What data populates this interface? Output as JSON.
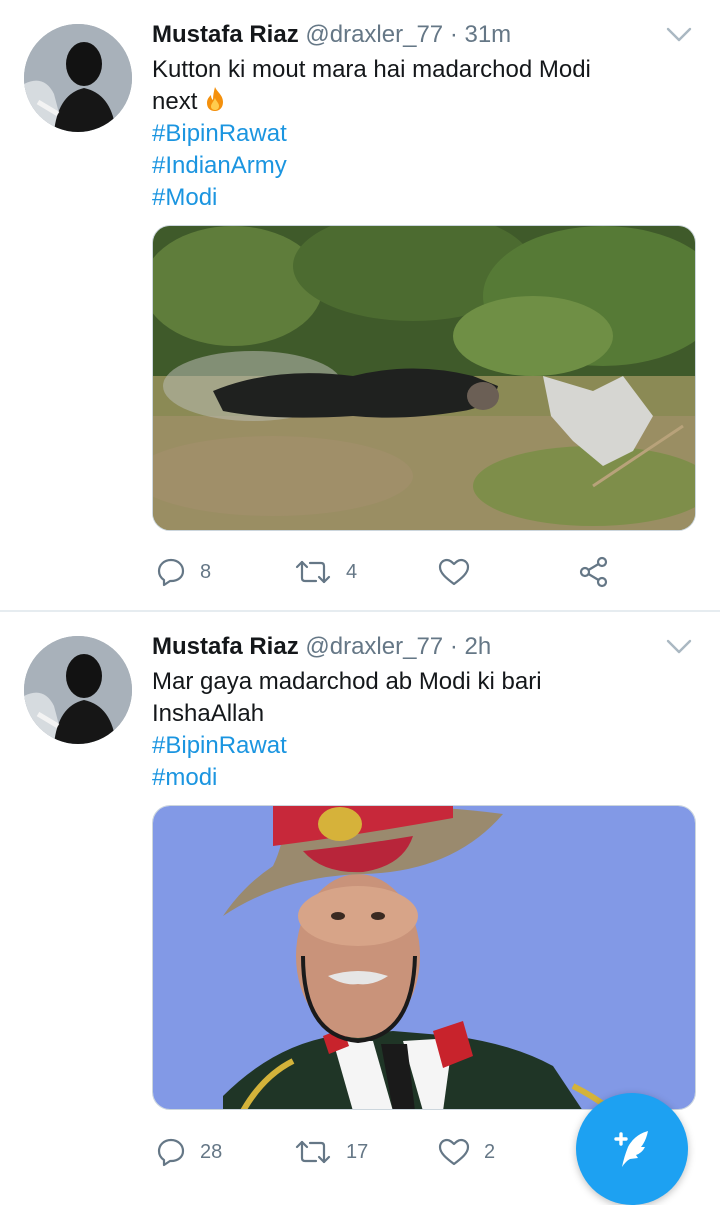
{
  "tweets": [
    {
      "name": "Mustafa Riaz",
      "handle": "@draxler_77",
      "dot": "·",
      "time": "31m",
      "text_lines": [
        "Kutton ki mout mara hai madarchod Modi",
        "next"
      ],
      "emoji": "fire-emoji",
      "hashtags": [
        "#BipinRawat",
        "#IndianArmy",
        "#Modi"
      ],
      "media": "photo-burned-body-in-grass",
      "replies": "8",
      "retweets": "4",
      "likes": ""
    },
    {
      "name": "Mustafa Riaz",
      "handle": "@draxler_77",
      "dot": "·",
      "time": "2h",
      "text_lines": [
        "Mar gaya madarchod ab Modi ki bari",
        "InshaAllah"
      ],
      "hashtags": [
        "#BipinRawat",
        "#modi"
      ],
      "media": "photo-army-general-portrait",
      "replies": "28",
      "retweets": "17",
      "likes": "2"
    }
  ],
  "icons": {
    "reply": "reply-icon",
    "retweet": "retweet-icon",
    "like": "heart-icon",
    "share": "share-icon",
    "menu": "chevron-down-icon",
    "compose": "compose-tweet-icon"
  },
  "colors": {
    "link": "#1b95e0",
    "secondary_text": "#657786",
    "fab": "#1da1f2",
    "divider": "#e6ecf0"
  }
}
